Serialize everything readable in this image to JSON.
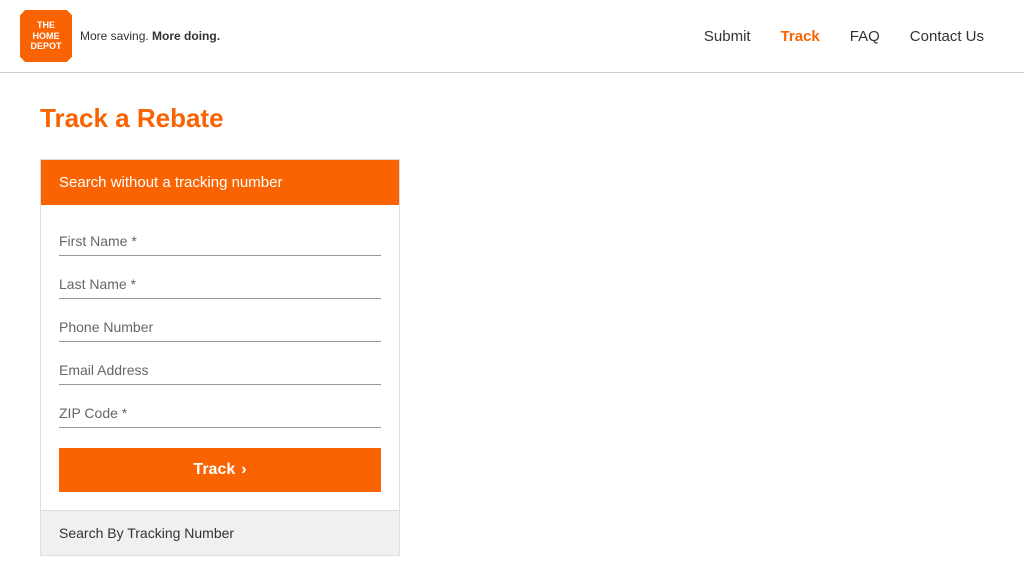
{
  "header": {
    "logo": {
      "line1": "THE",
      "line2": "HOME",
      "line3": "DEPOT"
    },
    "tagline": "More saving. More doing.",
    "nav": [
      {
        "label": "Submit",
        "active": false
      },
      {
        "label": "Track",
        "active": true
      },
      {
        "label": "FAQ",
        "active": false
      },
      {
        "label": "Contact Us",
        "active": false
      }
    ]
  },
  "main": {
    "page_title": "Track a Rebate",
    "form": {
      "section_header": "Search without a tracking number",
      "fields": [
        {
          "placeholder": "First Name *"
        },
        {
          "placeholder": "Last Name *"
        },
        {
          "placeholder": "Phone Number"
        },
        {
          "placeholder": "Email Address"
        },
        {
          "placeholder": "ZIP Code *"
        }
      ],
      "track_button": "Track",
      "footer_link": "Search By Tracking Number"
    }
  }
}
